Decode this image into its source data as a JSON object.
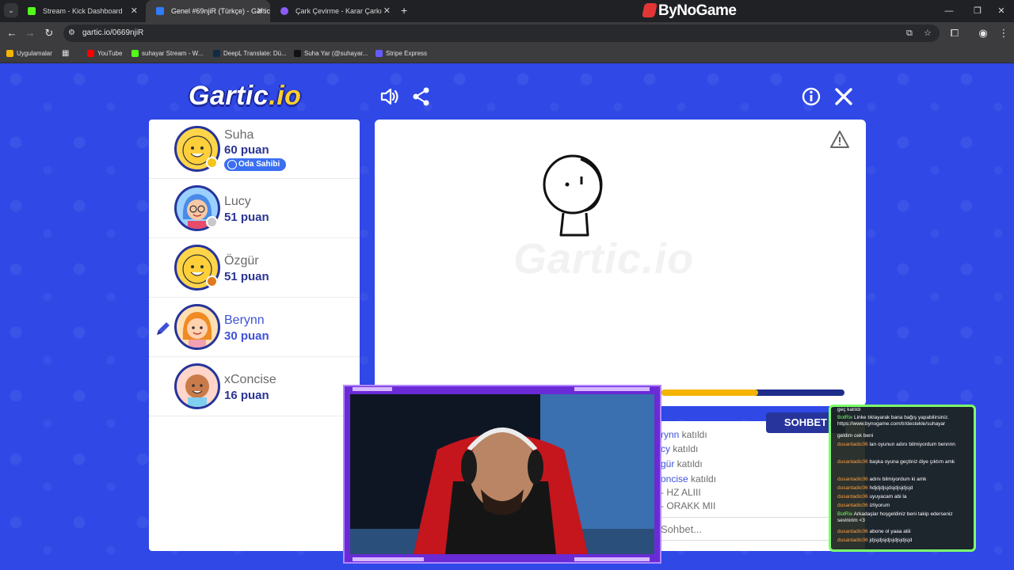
{
  "browser": {
    "tabs": [
      {
        "title": "Stream - Kick Dashboard",
        "color": "#53fc18"
      },
      {
        "title": "Genel #69njiR (Türkçe) - Gartic",
        "color": "#2f7cf6"
      },
      {
        "title": "Çark Çevirme - Karar Çarkı",
        "color": "#8a5cf6"
      }
    ],
    "brand": "ByNoGame",
    "url": "gartic.io/0669njiR",
    "bookmarks": [
      {
        "label": "Uygulamalar",
        "color": "#f4b400"
      },
      {
        "label": "YouTube",
        "color": "#ff0000"
      },
      {
        "label": "suhayar Stream - W...",
        "color": "#53fc18"
      },
      {
        "label": "DeepL Translate: Dü...",
        "color": "#0f2b46"
      },
      {
        "label": "Suha Yar (@suhayar...",
        "color": "#111111"
      },
      {
        "label": "Stripe Express",
        "color": "#635bff"
      }
    ]
  },
  "game": {
    "logo_main": "Gartic",
    "logo_suffix": ".io",
    "owner_badge": "Oda Sahibi",
    "players": [
      {
        "name": "Suha",
        "score": "60 puan",
        "status_color": "#f5c518",
        "owner": true,
        "drawing": false
      },
      {
        "name": "Lucy",
        "score": "51 puan",
        "status_color": "#c8c8c8",
        "owner": false,
        "drawing": false
      },
      {
        "name": "Özgür",
        "score": "51 puan",
        "status_color": "#e07b1a",
        "owner": false,
        "drawing": false
      },
      {
        "name": "Berynn",
        "score": "30 puan",
        "status_color": "",
        "owner": false,
        "drawing": true
      },
      {
        "name": "xConcise",
        "score": "16 puan",
        "status_color": "",
        "owner": false,
        "drawing": false
      }
    ],
    "timer_fraction": 0.53,
    "chat_tab": "SOHBET",
    "chat_lines": [
      {
        "who": "rynn",
        "text": " katıldı"
      },
      {
        "who": "cy",
        "text": " katıldı"
      },
      {
        "who": "gür",
        "text": " katıldı"
      },
      {
        "who": "oncise",
        "text": " katıldı"
      },
      {
        "who": "",
        "text": "- HZ ALIII"
      },
      {
        "who": "",
        "text": "- ORAKK MII"
      }
    ],
    "chat_placeholder": "Sohbet..."
  },
  "stream_chat": [
    {
      "name": "",
      "text": "geç katıldı",
      "bot": false
    },
    {
      "name": "BotRix",
      "text": "Linke tıklayarak bana bağış yapabilirsiniz. https://www.bynogame.com/tr/destekle/suhayar",
      "bot": true
    },
    {
      "name": "",
      "text": "geldim cek beni",
      "bot": false
    },
    {
      "name": "dusantadic06",
      "text": "lan oyunun adını bilmiyordum bennnn",
      "bot": false
    },
    {
      "name": "dusantadic06",
      "text": "başka oyuna geçtiniz diye çıktım amk",
      "bot": false
    },
    {
      "name": "dusantadic06",
      "text": "adını bilmiyordum ki amk",
      "bot": false
    },
    {
      "name": "dusantadic06",
      "text": "hdjdjdjsjdsjdjsjdjsjd",
      "bot": false
    },
    {
      "name": "dusantadic06",
      "text": "uyuyacam abi la",
      "bot": false
    },
    {
      "name": "dusantadic06",
      "text": "izliyorum",
      "bot": false
    },
    {
      "name": "BotRix",
      "text": "Arkadaşlar hoşgeldiniz beni takip ederseniz sevinirim <3",
      "bot": true
    },
    {
      "name": "dusantadic06",
      "text": "abone ol yaaa aliii",
      "bot": false
    },
    {
      "name": "dusantadic06",
      "text": "jdjsjdjsjdjsjdjsjdjsjd",
      "bot": false
    }
  ]
}
